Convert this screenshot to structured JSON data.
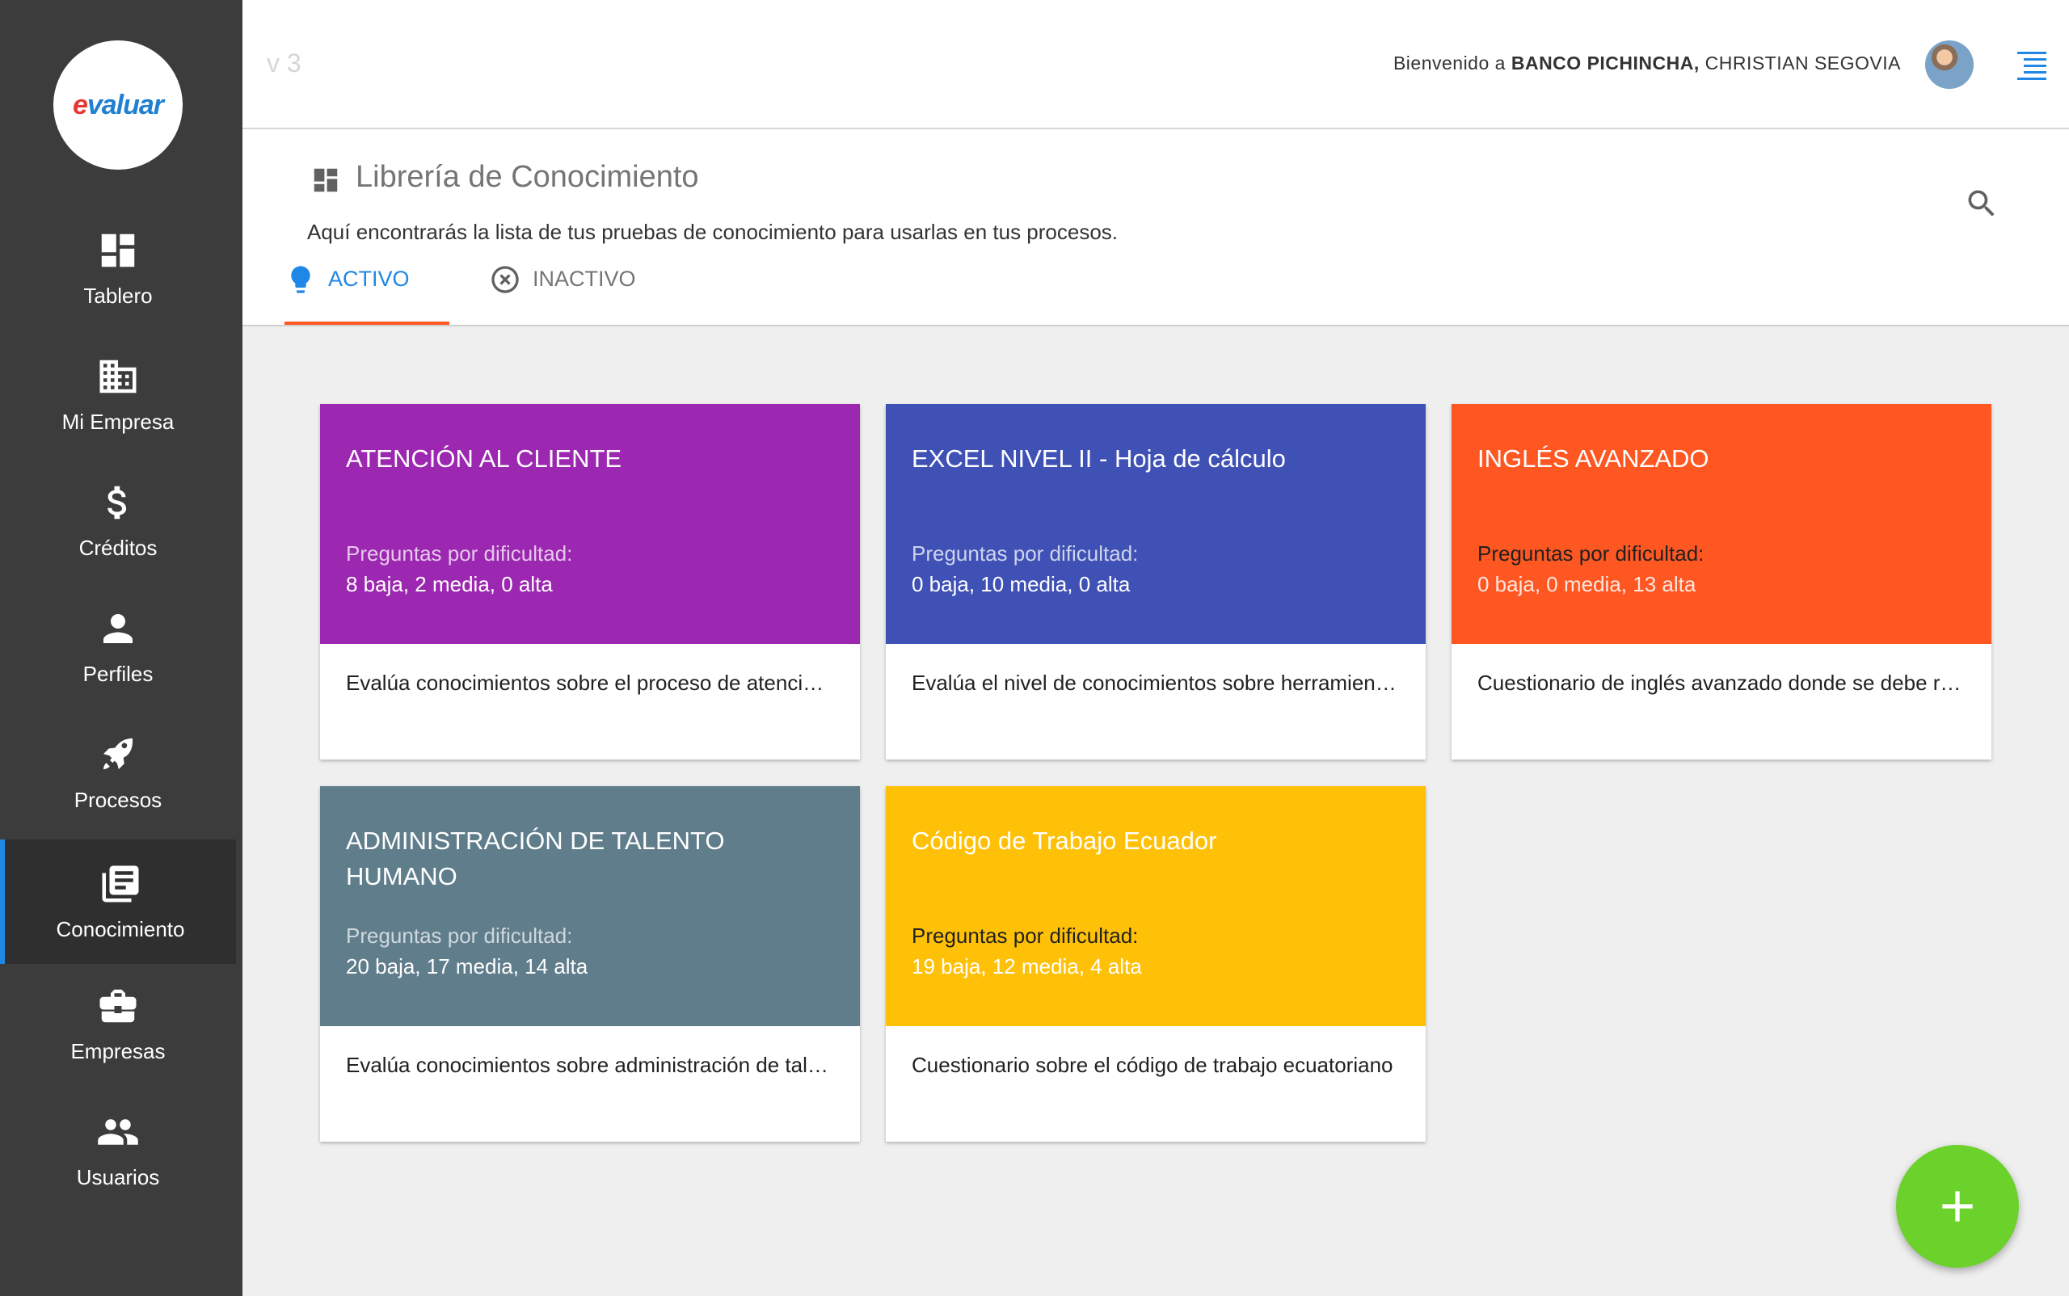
{
  "brand": {
    "logo_text_e": "e",
    "logo_text_rest": "valuar"
  },
  "header": {
    "version": "v 3",
    "welcome_prefix": "Bienvenido a ",
    "company": "BANCO PICHINCHA,",
    "user": " CHRISTIAN SEGOVIA"
  },
  "sidebar": {
    "items": [
      {
        "label": "Tablero",
        "icon": "dashboard-icon"
      },
      {
        "label": "Mi Empresa",
        "icon": "building-icon"
      },
      {
        "label": "Créditos",
        "icon": "dollar-icon"
      },
      {
        "label": "Perfiles",
        "icon": "person-icon"
      },
      {
        "label": "Procesos",
        "icon": "rocket-icon"
      },
      {
        "label": "Conocimiento",
        "icon": "library-books-icon",
        "active": true
      },
      {
        "label": "Empresas",
        "icon": "briefcase-icon"
      },
      {
        "label": "Usuarios",
        "icon": "group-icon"
      }
    ]
  },
  "page": {
    "title": "Librería de Conocimiento",
    "subtitle": "Aquí encontrarás la lista de tus pruebas de conocimiento para usarlas en tus procesos.",
    "tabs": {
      "active": "ACTIVO",
      "inactive": "INACTIVO"
    }
  },
  "cards": [
    {
      "title": "ATENCIÓN AL CLIENTE",
      "questions_label": "Preguntas por dificultad:",
      "questions": "8 baja, 2 media, 0 alta",
      "description": "Evalúa conocimientos sobre el proceso de atención al cliente",
      "color": "#9c27b0"
    },
    {
      "title": "EXCEL NIVEL II - Hoja de cálculo",
      "questions_label": "Preguntas por dificultad:",
      "questions": "0 baja, 10 media, 0 alta",
      "description": "Evalúa el nivel de conocimientos sobre herramientas de hoja de cálculo",
      "color": "#3f51b5"
    },
    {
      "title": "INGLÉS AVANZADO",
      "questions_label": "Preguntas por dificultad:",
      "questions": "0 baja, 0 media, 13 alta",
      "description": "Cuestionario de inglés avanzado donde se debe responder",
      "color": "#ff5722"
    },
    {
      "title": "ADMINISTRACIÓN DE TALENTO HUMANO",
      "questions_label": "Preguntas por dificultad:",
      "questions": "20 baja, 17 media, 14 alta",
      "description": "Evalúa conocimientos sobre administración de talento humano",
      "color": "#607d8b"
    },
    {
      "title": "Código de Trabajo Ecuador",
      "questions_label": "Preguntas por dificultad:",
      "questions": "19 baja, 12 media, 4 alta",
      "description": "Cuestionario sobre el código de trabajo ecuatoriano",
      "color": "#ffc107"
    }
  ],
  "fab": {
    "icon": "plus-icon"
  }
}
